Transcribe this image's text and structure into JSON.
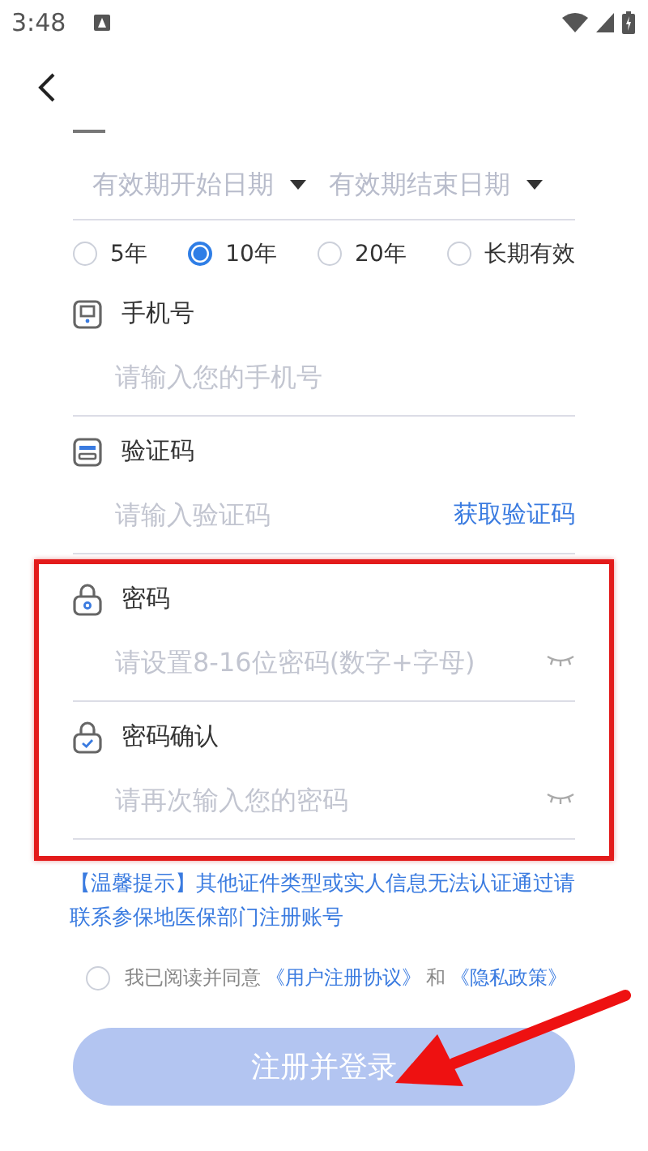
{
  "status_bar": {
    "time": "3:48"
  },
  "validity": {
    "start_placeholder": "有效期开始日期",
    "end_placeholder": "有效期结束日期"
  },
  "durations": [
    {
      "label": "5年",
      "selected": false
    },
    {
      "label": "10年",
      "selected": true
    },
    {
      "label": "20年",
      "selected": false
    },
    {
      "label": "长期有效",
      "selected": false
    }
  ],
  "fields": [
    {
      "kind": "phone",
      "label": "手机号",
      "placeholder": "请输入您的手机号"
    },
    {
      "kind": "code",
      "label": "验证码",
      "placeholder": "请输入验证码",
      "action": "获取验证码"
    }
  ],
  "highlight_frame": {
    "fields": [
      {
        "kind": "password",
        "label": "密码",
        "placeholder": "请设置8-16位密码(数字+字母)"
      },
      {
        "kind": "confirm",
        "label": "密码确认",
        "placeholder": "请再次输入您的密码"
      }
    ]
  },
  "tip": "【温馨提示】其他证件类型或实人信息无法认证通过请联系参保地医保部门注册账号",
  "agreement": {
    "checked": false,
    "text": "我已阅读并同意",
    "link1": "《用户注册协议》",
    "joiner": "和",
    "link2": "《隐私政策》"
  },
  "submit": {
    "label": "注册并登录",
    "disabled": true
  }
}
